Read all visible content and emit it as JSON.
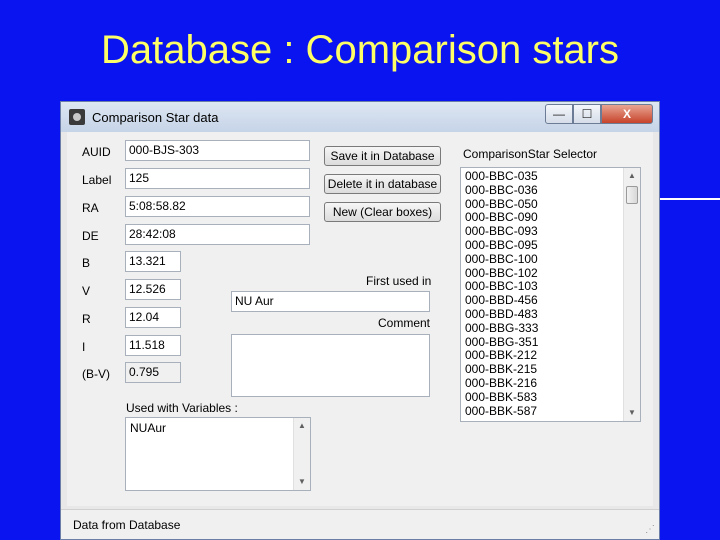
{
  "slide": {
    "title": "Database : Comparison stars"
  },
  "window": {
    "title": "Comparison Star data",
    "minimize_glyph": "—",
    "maximize_glyph": "☐",
    "close_glyph": "X"
  },
  "form": {
    "auid": {
      "label": "AUID",
      "value": "000-BJS-303"
    },
    "label": {
      "label": "Label",
      "value": "125"
    },
    "ra": {
      "label": "RA",
      "value": "5:08:58.82"
    },
    "de": {
      "label": "DE",
      "value": "28:42:08"
    },
    "b": {
      "label": "B",
      "value": "13.321"
    },
    "v": {
      "label": "V",
      "value": "12.526"
    },
    "r": {
      "label": "R",
      "value": "12.04"
    },
    "i": {
      "label": "I",
      "value": "11.518"
    },
    "bv": {
      "label": "(B-V)",
      "value": "0.795"
    },
    "first_used": {
      "label": "First used in",
      "value": "NU Aur"
    },
    "comment": {
      "label": "Comment",
      "value": ""
    },
    "used_with": {
      "label": "Used with Variables :",
      "value": "NUAur"
    }
  },
  "buttons": {
    "save": "Save it in Database",
    "delete": "Delete it in database",
    "new": "New (Clear boxes)"
  },
  "selector": {
    "label": "ComparisonStar Selector",
    "items": [
      "000-BBC-035",
      "000-BBC-036",
      "000-BBC-050",
      "000-BBC-090",
      "000-BBC-093",
      "000-BBC-095",
      "000-BBC-100",
      "000-BBC-102",
      "000-BBC-103",
      "000-BBD-456",
      "000-BBD-483",
      "000-BBG-333",
      "000-BBG-351",
      "000-BBK-212",
      "000-BBK-215",
      "000-BBK-216",
      "000-BBK-583",
      "000-BBK-587"
    ]
  },
  "status": {
    "text": "Data from Database",
    "grip": "⋰"
  },
  "icons": {
    "scroll_up": "▲",
    "scroll_down": "▼"
  }
}
